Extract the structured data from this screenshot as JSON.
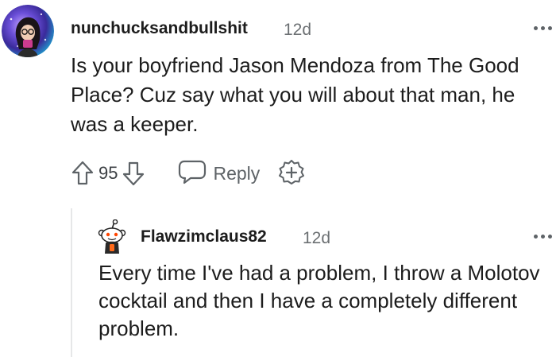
{
  "comment": {
    "username": "nunchucksandbullshit",
    "age": "12d",
    "body": "Is your boyfriend Jason Mendoza from The Good Place? Cuz say what you will about that man, he was a keeper.",
    "score": "95",
    "reply_label": "Reply"
  },
  "reply": {
    "username": "Flawzimclaus82",
    "age": "12d",
    "body": "Every time I've had a problem, I throw a Molotov cocktail and then I have a completely different problem."
  },
  "icons": {
    "avatar_main": "user-avatar-galaxy",
    "avatar_reply": "snoo-avatar",
    "upvote": "upvote-arrow-icon",
    "downvote": "downvote-arrow-icon",
    "reply": "speech-bubble-icon",
    "award": "award-plus-icon",
    "more": "more-options-icon"
  },
  "colors": {
    "text": "#1c1c1c",
    "meta": "#6b6f72",
    "icon": "#5e6367",
    "thread_line": "#e6e7e8"
  }
}
